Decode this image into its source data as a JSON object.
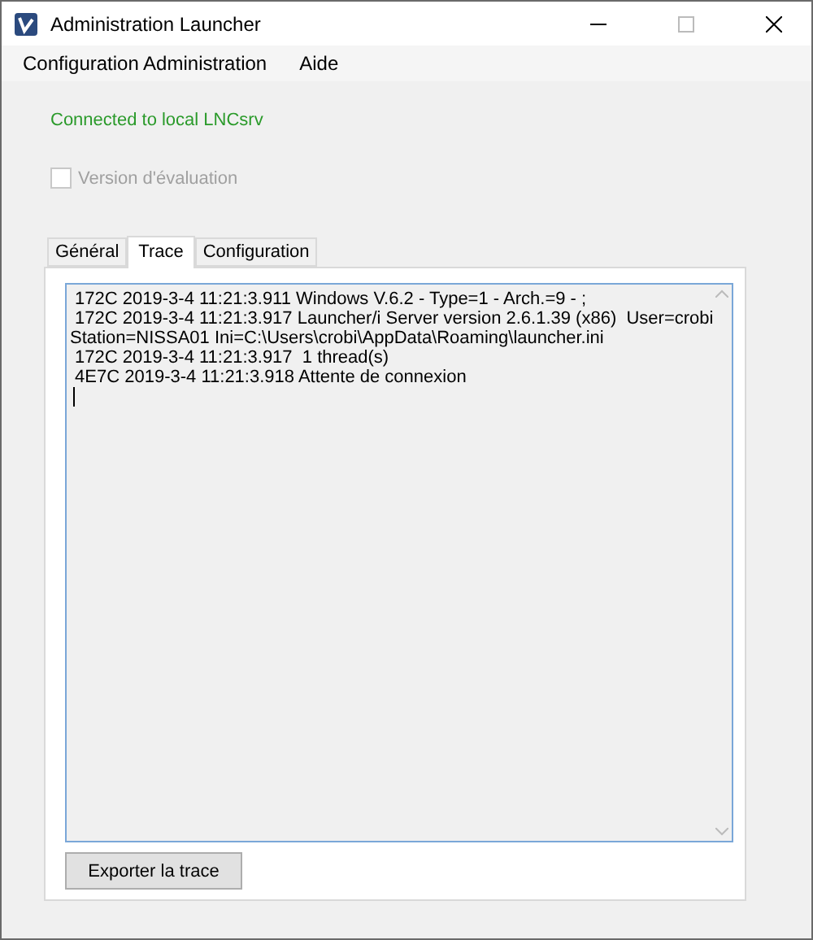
{
  "window": {
    "title": "Administration Launcher"
  },
  "menu": [
    "Configuration Administration",
    "Aide"
  ],
  "status": "Connected to local LNCsrv",
  "evaluation": {
    "label": "Version d'évaluation",
    "checked": false,
    "disabled": true
  },
  "tabs": [
    {
      "label": "Général",
      "selected": false
    },
    {
      "label": "Trace",
      "selected": true
    },
    {
      "label": "Configuration",
      "selected": false
    }
  ],
  "trace_lines": [
    " 172C 2019-3-4 11:21:3.911 Windows V.6.2 - Type=1 - Arch.=9 - ;",
    " 172C 2019-3-4 11:21:3.917 Launcher/i Server version 2.6.1.39 (x86)  User=crobi",
    "Station=NISSA01 Ini=C:\\Users\\crobi\\AppData\\Roaming\\launcher.ini",
    " 172C 2019-3-4 11:21:3.917  1 thread(s)",
    " 4E7C 2019-3-4 11:21:3.918 Attente de connexion"
  ],
  "export_button": "Exporter la trace"
}
